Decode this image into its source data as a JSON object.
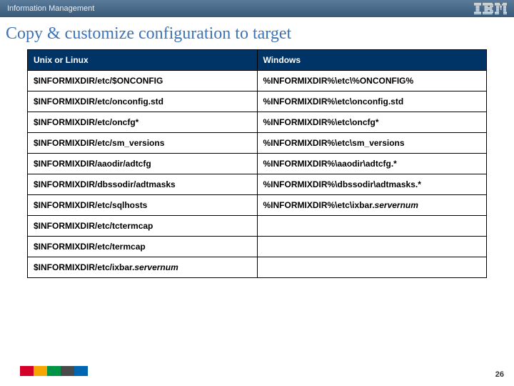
{
  "header": {
    "breadcrumb": "Information Management",
    "logo": "IBM"
  },
  "title": "Copy & customize configuration to target",
  "table": {
    "headers": [
      "Unix or Linux",
      "Windows"
    ],
    "rows": [
      {
        "unix": "$INFORMIXDIR/etc/$ONCONFIG",
        "win": "%INFORMIXDIR%\\etc\\%ONCONFIG%"
      },
      {
        "unix": "$INFORMIXDIR/etc/onconfig.std",
        "win": "%INFORMIXDIR%\\etc\\onconfig.std"
      },
      {
        "unix": "$INFORMIXDIR/etc/oncfg*",
        "win": "%INFORMIXDIR%\\etc\\oncfg*"
      },
      {
        "unix": "$INFORMIXDIR/etc/sm_versions",
        "win": "%INFORMIXDIR%\\etc\\sm_versions"
      },
      {
        "unix": "$INFORMIXDIR/aaodir/adtcfg",
        "win": "%INFORMIXDIR%\\aaodir\\adtcfg.*"
      },
      {
        "unix": "$INFORMIXDIR/dbssodir/adtmasks",
        "win": "%INFORMIXDIR%\\dbssodir\\adtmasks.*"
      },
      {
        "unix_prefix": "$INFORMIXDIR/etc/sqlhosts",
        "win_prefix": "%INFORMIXDIR%\\etc\\ixbar.",
        "win_italic": "servernum"
      },
      {
        "unix": "$INFORMIXDIR/etc/tctermcap",
        "win": ""
      },
      {
        "unix": "$INFORMIXDIR/etc/termcap",
        "win": ""
      },
      {
        "unix_prefix": "$INFORMIXDIR/etc/ixbar.",
        "unix_italic": "servernum",
        "win": ""
      }
    ]
  },
  "footer": {
    "colors": [
      "#d4002a",
      "#f5a600",
      "#009447",
      "#4a4a4a",
      "#0066b2"
    ],
    "page": "26"
  }
}
